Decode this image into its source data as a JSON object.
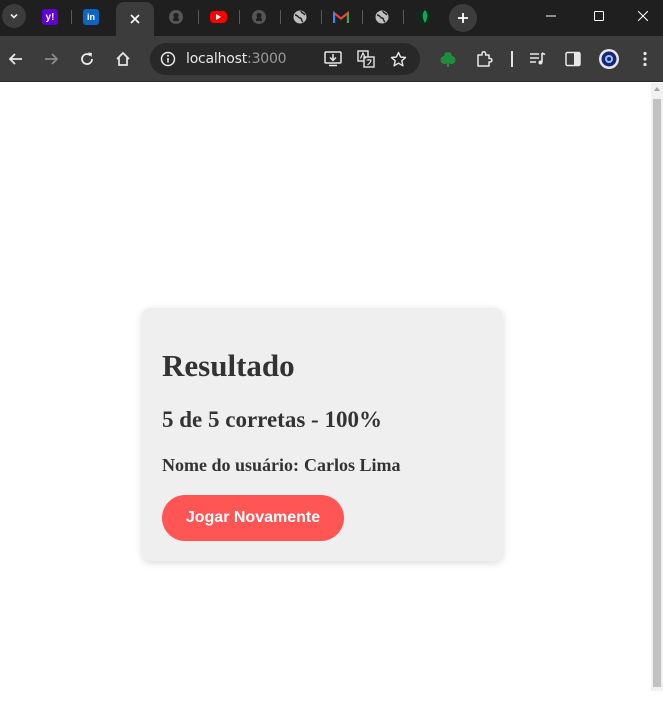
{
  "browser": {
    "tabs": [
      {
        "icon": "yahoo-favicon",
        "glyph": "y!"
      },
      {
        "icon": "linkedin-favicon",
        "glyph": "in"
      },
      {
        "icon": "close-icon",
        "active": true
      },
      {
        "icon": "github-favicon"
      },
      {
        "icon": "youtube-favicon"
      },
      {
        "icon": "github-favicon"
      },
      {
        "icon": "globe-favicon"
      },
      {
        "icon": "gmail-favicon"
      },
      {
        "icon": "globe-favicon"
      },
      {
        "icon": "mongodb-favicon"
      }
    ],
    "address": {
      "host": "localhost",
      "port": ":3000"
    }
  },
  "result": {
    "title": "Resultado",
    "score_text": "5 de 5 corretas - 100%",
    "user_label": "Nome do usuário:",
    "user_name": "Carlos Lima",
    "play_again_label": "Jogar Novamente"
  },
  "colors": {
    "accent_button": "#ff5555",
    "card_background": "#efefef",
    "text": "#333333",
    "browser_frame": "#1f1f1f",
    "toolbar": "#3c3c3c"
  }
}
